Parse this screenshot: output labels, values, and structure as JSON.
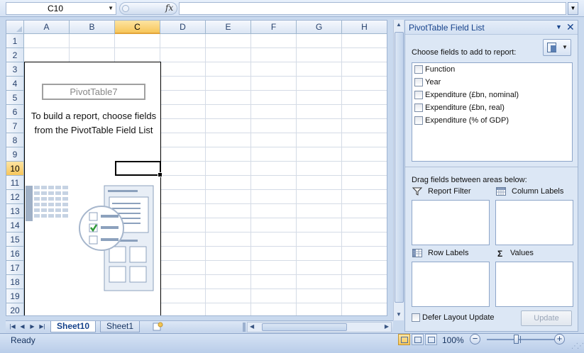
{
  "formula_bar": {
    "name_box": "C10",
    "fx_label": "fx",
    "formula_value": ""
  },
  "grid": {
    "columns": [
      "A",
      "B",
      "C",
      "D",
      "E",
      "F",
      "G",
      "H"
    ],
    "rows": [
      "1",
      "2",
      "3",
      "4",
      "5",
      "6",
      "7",
      "8",
      "9",
      "10",
      "11",
      "12",
      "13",
      "14",
      "15",
      "16",
      "17",
      "18",
      "19",
      "20"
    ],
    "selected_column": "C",
    "selected_row": "10"
  },
  "pivot_placeholder": {
    "name": "PivotTable7",
    "message": "To build a report, choose fields from the PivotTable Field List"
  },
  "sheet_tabs": [
    {
      "label": "Sheet10",
      "active": true
    },
    {
      "label": "Sheet1",
      "active": false
    }
  ],
  "status_bar": {
    "ready": "Ready",
    "zoom": "100%",
    "zoom_minus": "−",
    "zoom_plus": "+"
  },
  "field_list": {
    "title": "PivotTable Field List",
    "choose_label": "Choose fields to add to report:",
    "fields": [
      {
        "label": "Function",
        "checked": false
      },
      {
        "label": "Year",
        "checked": false
      },
      {
        "label": "Expenditure (£bn, nominal)",
        "checked": false
      },
      {
        "label": "Expenditure (£bn, real)",
        "checked": false
      },
      {
        "label": "Expenditure (% of GDP)",
        "checked": false
      }
    ],
    "drag_label": "Drag fields between areas below:",
    "areas": {
      "report_filter": "Report Filter",
      "column_labels": "Column Labels",
      "row_labels": "Row Labels",
      "values": "Values"
    },
    "values_symbol": "Σ",
    "defer_label": "Defer Layout Update",
    "update_button": "Update"
  }
}
